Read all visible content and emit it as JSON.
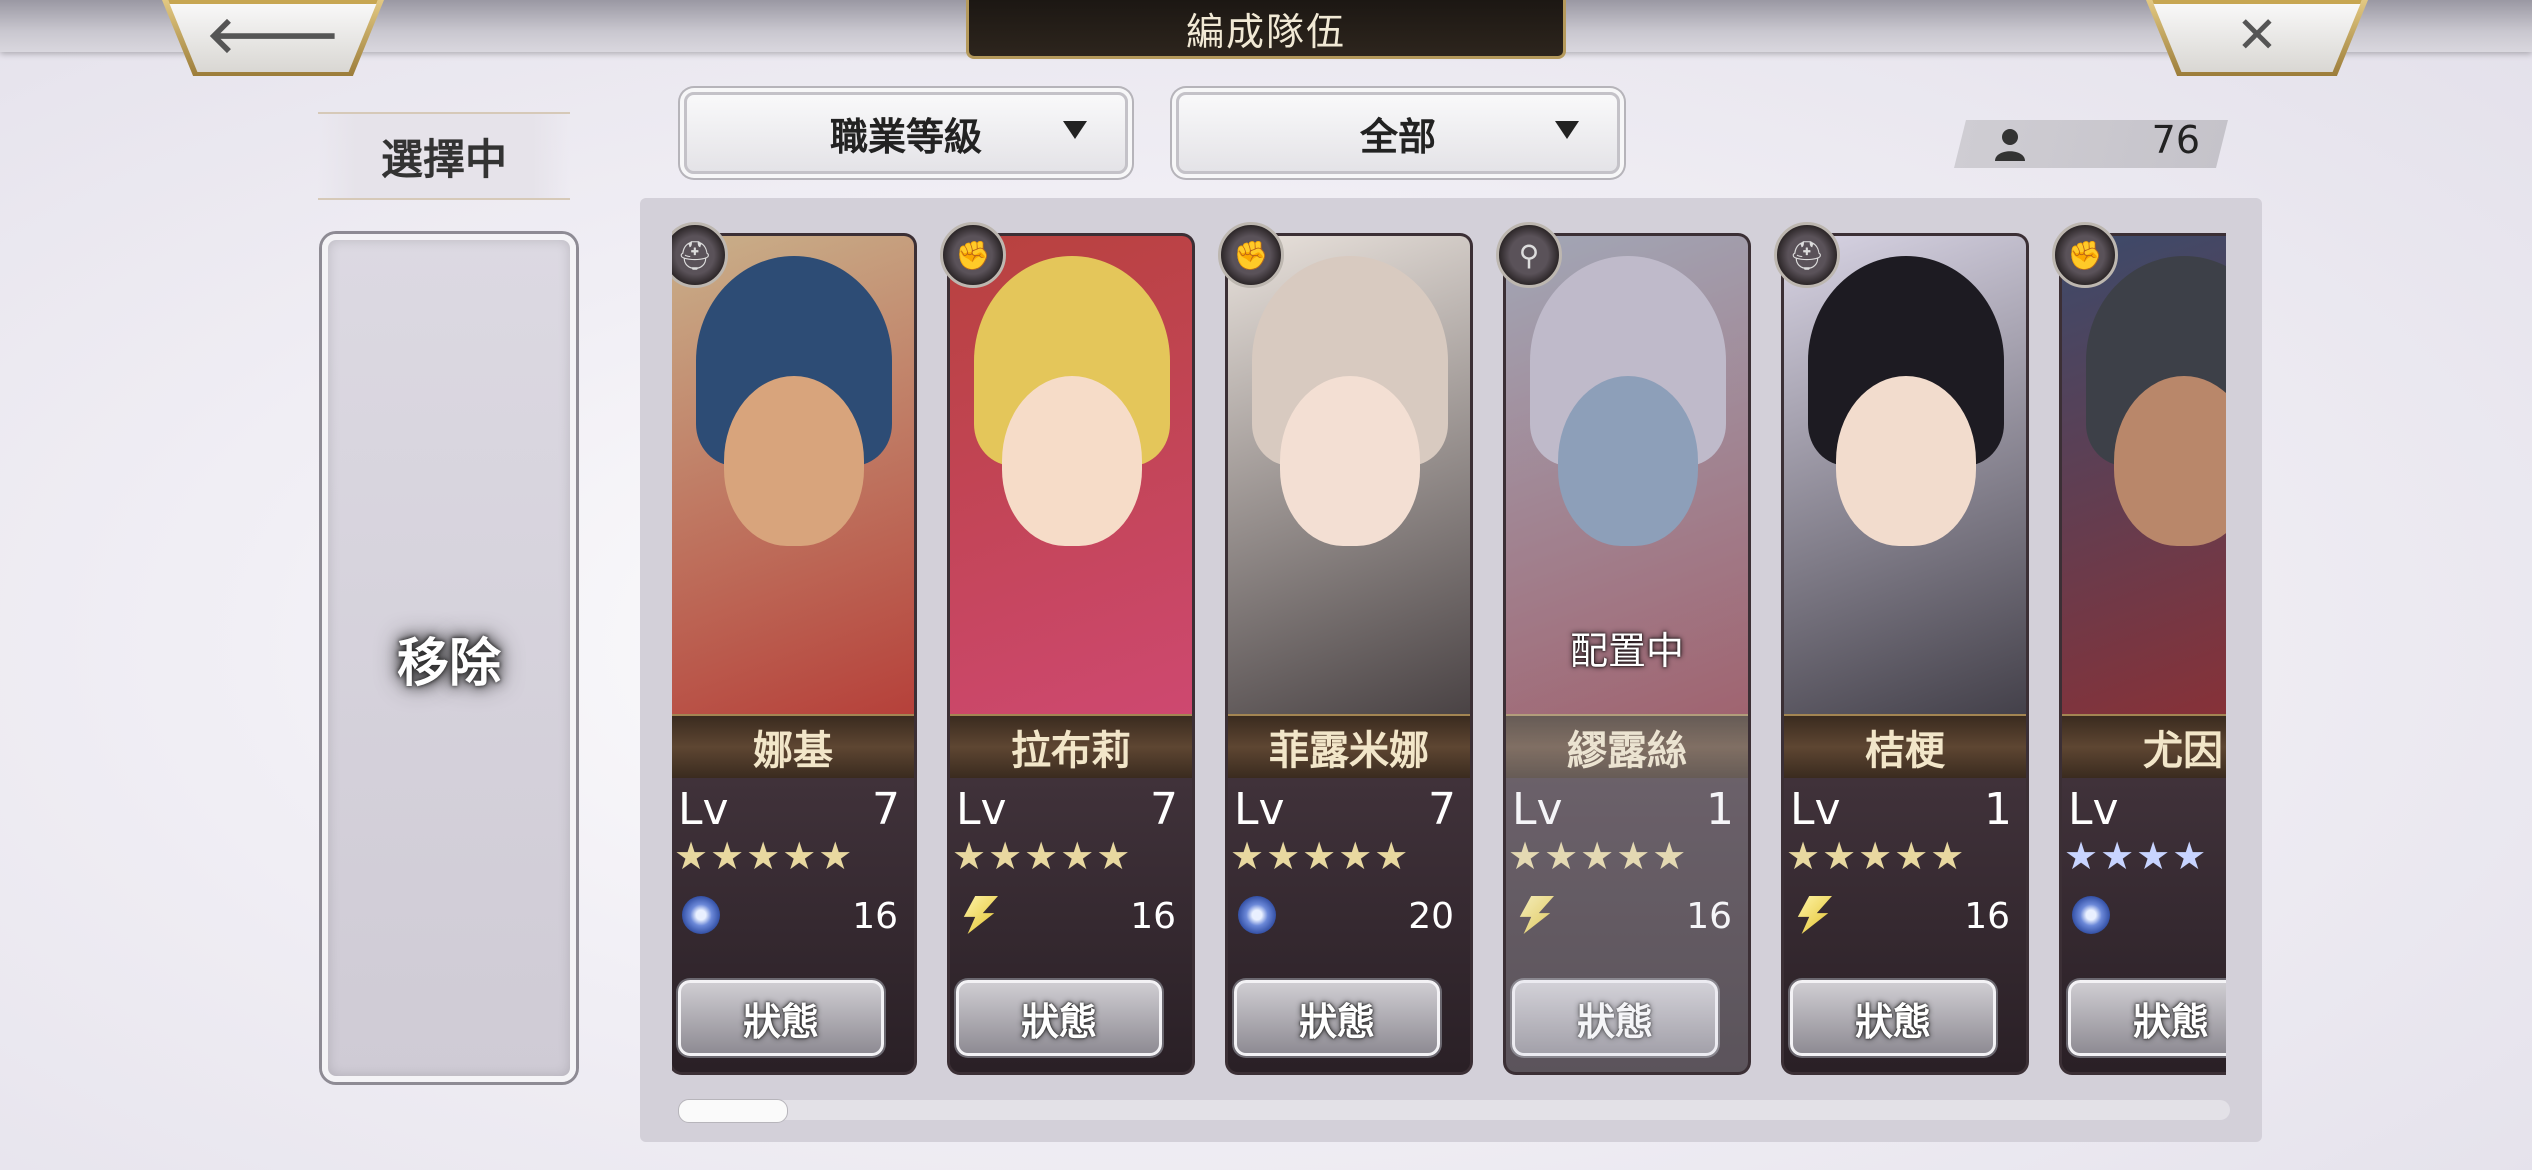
{
  "header": {
    "title": "編成隊伍",
    "back_glyph": "🡐",
    "close_glyph": "✕"
  },
  "left": {
    "selecting_label": "選擇中",
    "remove_label": "移除"
  },
  "filters": {
    "sort_value": "職業等級",
    "class_value": "全部"
  },
  "unit_count": "76",
  "level_prefix": "Lv",
  "status_label": "狀態",
  "scroll_position": 0.0,
  "units": [
    {
      "name": "娜基",
      "level": "7",
      "stars": "★★★★★",
      "element": "wind",
      "cost": "16",
      "class_icon": "hat-icon",
      "deployed": false,
      "colors": {
        "bg": "#c9b08a",
        "hair": "#2d4c75",
        "face": "#d8a47c",
        "accent": "#b22a2a"
      }
    },
    {
      "name": "拉布莉",
      "level": "7",
      "stars": "★★★★★",
      "element": "thunder",
      "cost": "16",
      "class_icon": "fist-icon",
      "deployed": false,
      "colors": {
        "bg": "#b8413e",
        "hair": "#e4c65a",
        "face": "#f6dcc8",
        "accent": "#d24a7a"
      }
    },
    {
      "name": "菲露米娜",
      "level": "7",
      "stars": "★★★★★",
      "element": "wind",
      "cost": "20",
      "class_icon": "fist-icon",
      "deployed": false,
      "colors": {
        "bg": "#e9e2dc",
        "hair": "#d8cac0",
        "face": "#f3dfd3",
        "accent": "#2a2326"
      }
    },
    {
      "name": "繆露絲",
      "level": "1",
      "stars": "★★★★★",
      "element": "thunder",
      "cost": "16",
      "class_icon": "spear-icon",
      "deployed": true,
      "deployed_label": "配置中",
      "colors": {
        "bg": "#8c93a4",
        "hair": "#b4adc0",
        "face": "#6f88a8",
        "accent": "#8a2430"
      }
    },
    {
      "name": "桔梗",
      "level": "1",
      "stars": "★★★★★",
      "element": "thunder",
      "cost": "16",
      "class_icon": "hat-icon",
      "deployed": false,
      "colors": {
        "bg": "#d8d4e4",
        "hair": "#1d1b22",
        "face": "#f2dccd",
        "accent": "#26232b"
      }
    },
    {
      "name": "尤因",
      "level": "",
      "stars": "★★★★",
      "stars_blue": true,
      "element": "wind",
      "cost": "",
      "class_icon": "fist-icon",
      "deployed": false,
      "colors": {
        "bg": "#3c4a6a",
        "hair": "#3d4048",
        "face": "#b9876a",
        "accent": "#9a2b2b"
      }
    }
  ]
}
